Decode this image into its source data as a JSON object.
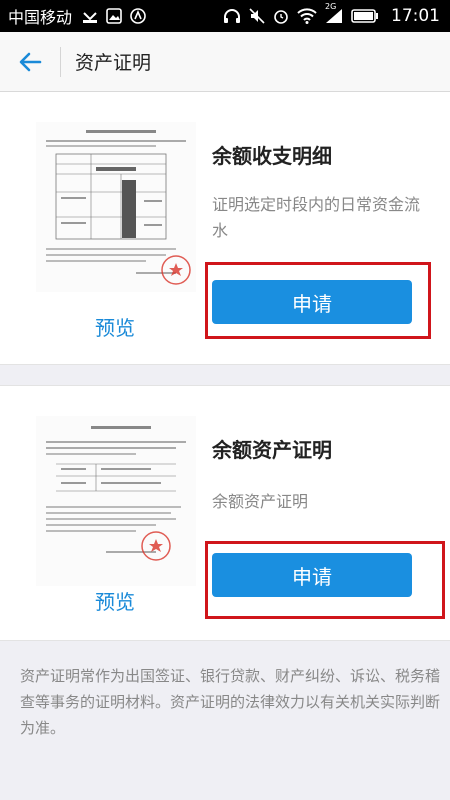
{
  "status_bar": {
    "carrier": "中国移动",
    "network": "2G",
    "time": "17:01"
  },
  "header": {
    "title": "资产证明",
    "back_icon": "arrow-left-icon"
  },
  "cards": [
    {
      "title": "余额收支明细",
      "description": "证明选定时段内的日常资金流水",
      "preview_label": "预览",
      "apply_label": "申请"
    },
    {
      "title": "余额资产证明",
      "description": "余额资产证明",
      "preview_label": "预览",
      "apply_label": "申请"
    }
  ],
  "footnote": "资产证明常作为出国签证、银行贷款、财产纠纷、诉讼、税务稽查等事务的证明材料。资产证明的法律效力以有关机关实际判断为准。",
  "colors": {
    "accent": "#1a8fe0",
    "highlight": "#d0151b",
    "seal": "#d9342b"
  }
}
